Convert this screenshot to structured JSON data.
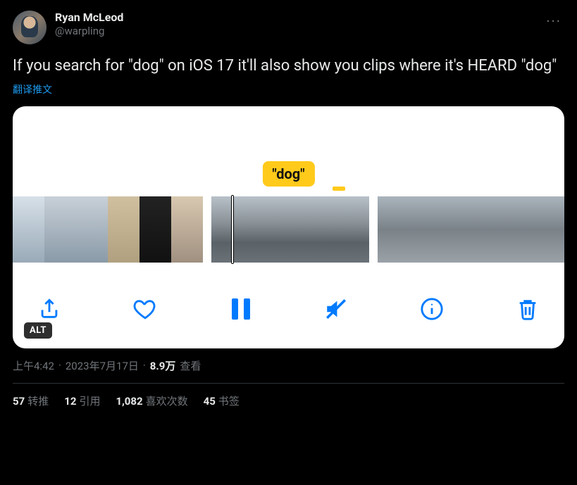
{
  "author": {
    "display_name": "Ryan McLeod",
    "handle": "@warpling"
  },
  "body_text": "If you search for \"dog\" on iOS 17 it'll also show you clips where it's HEARD \"dog\"",
  "translate_label": "翻译推文",
  "media": {
    "caption_tag": "\"dog\"",
    "alt_badge": "ALT",
    "toolbar": {
      "share": "share",
      "like": "like",
      "pause": "pause",
      "mute": "mute",
      "info": "info",
      "delete": "delete"
    }
  },
  "meta": {
    "time": "上午4:42",
    "sep": " · ",
    "date": "2023年7月17日",
    "views_num": "8.9万",
    "views_label": "查看"
  },
  "stats": {
    "retweets_num": "57",
    "retweets_label": "转推",
    "quotes_num": "12",
    "quotes_label": "引用",
    "likes_num": "1,082",
    "likes_label": "喜欢次数",
    "bookmarks_num": "45",
    "bookmarks_label": "书签"
  },
  "more_label": "···"
}
